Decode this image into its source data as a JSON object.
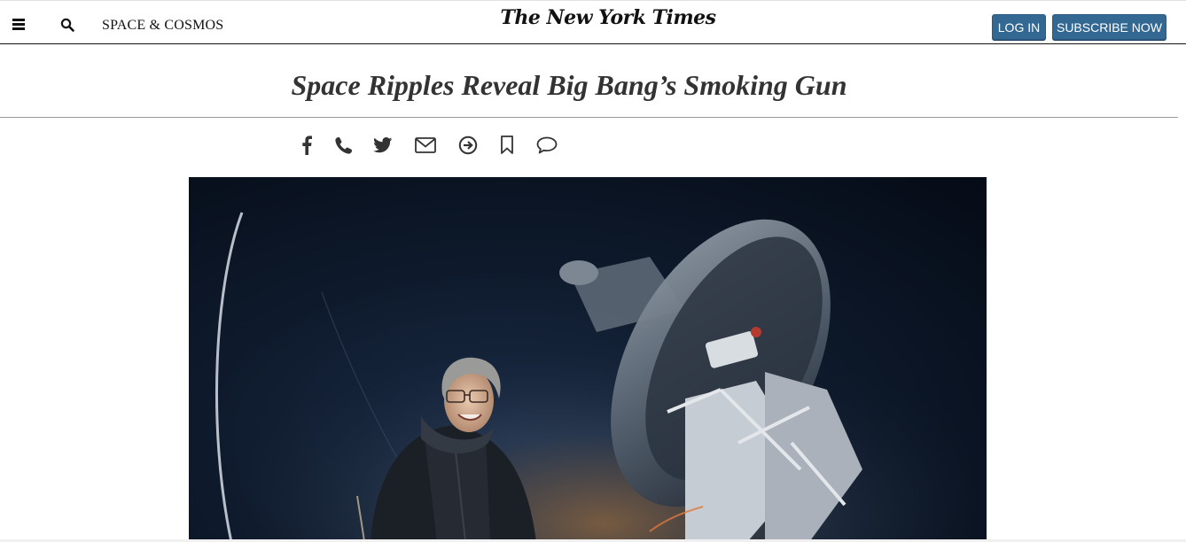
{
  "header": {
    "section_label": "SPACE & COSMOS",
    "logo_text": "The New York Times",
    "login_label": "LOG IN",
    "subscribe_label": "SUBSCRIBE NOW"
  },
  "article": {
    "headline": "Space Ripples Reveal Big Bang’s Smoking Gun"
  },
  "share_icons": [
    "facebook-icon",
    "phone-icon",
    "twitter-icon",
    "email-icon",
    "share-arrow-icon",
    "bookmark-icon",
    "comment-icon"
  ],
  "colors": {
    "button_blue": "#326891",
    "text": "#121212",
    "headline": "#333333"
  }
}
